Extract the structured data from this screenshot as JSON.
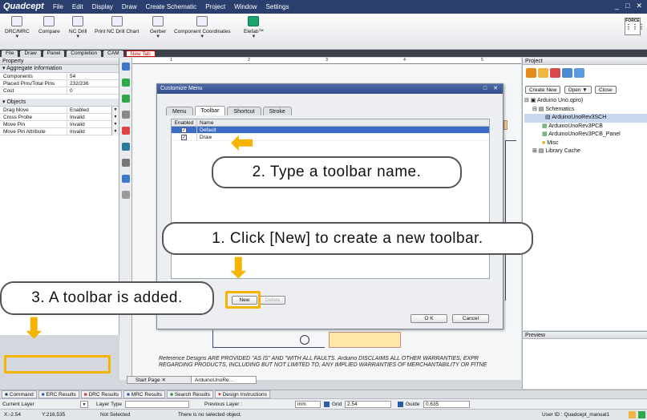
{
  "app": {
    "name": "Quadcept",
    "menus": [
      "File",
      "Edit",
      "Display",
      "Draw",
      "Create Schematic",
      "Project",
      "Window",
      "Settings"
    ]
  },
  "toolbar": {
    "items": [
      "DRC/MRC",
      "Compare",
      "NC Drill",
      "Print NC Drill Chart",
      "Gerber",
      "Component Coordinates",
      "Elefab™"
    ],
    "force_label": "FORCE"
  },
  "doc_tabs": [
    "File",
    "Draw",
    "Panel",
    "Completion",
    "CAM",
    "New Tab"
  ],
  "property_panel": {
    "title": "Property",
    "aggregate_title": "Aggregate Information",
    "aggregate_rows": [
      {
        "key": "Components",
        "value": "54"
      },
      {
        "key": "Placed Pins/Total Pins",
        "value": "232/236"
      },
      {
        "key": "Cost",
        "value": "0"
      }
    ],
    "objects_title": "Objects",
    "object_rows": [
      {
        "key": "Drag Move",
        "value": "Enabled"
      },
      {
        "key": "Cross Probe",
        "value": "Invalid"
      },
      {
        "key": "Move Pin",
        "value": "Invalid"
      },
      {
        "key": "Move Pin Attribute",
        "value": "Invalid"
      }
    ]
  },
  "ruler": [
    "1",
    "2",
    "3",
    "4",
    "5"
  ],
  "dialog": {
    "title": "Customize Menu",
    "tabs": [
      "Menu",
      "Toolbar",
      "Shortcut",
      "Stroke"
    ],
    "columns": [
      "Enabled",
      "Name"
    ],
    "rows": [
      {
        "name": "Default",
        "checked": true
      },
      {
        "name": "Draw",
        "checked": true
      }
    ],
    "new_label": "New",
    "delete_label": "Delete",
    "ok_label": "O K",
    "cancel_label": "Cancel"
  },
  "project_panel": {
    "title": "Project",
    "create_new": "Create New",
    "open": "Open ▼",
    "close": "Close",
    "tree": [
      "Arduino Uno.qpro)",
      "Schematics",
      "ArduinoUnoRev3SCH",
      "ArduinoUnoRev3PCB",
      "ArduinoUnoRev3PCB_Panel",
      "Misc",
      "Library Cache"
    ]
  },
  "preview_panel": {
    "title": "Preview"
  },
  "disclaimer": {
    "line1": "Reference Designs ARE PROVIDED \"AS IS\" AND \"WITH ALL FAULTS. Arduino DISCLAIMS ALL OTHER WARRANTIES, EXPR",
    "line2": "REGARDING PRODUCTS, INCLUDING BUT NOT LIMITED TO, ANY IMPLIED WARRANTIES OF MERCHANTABILITY OR FITNE"
  },
  "page_tabs": [
    "Start Page",
    "ArduinoUnoRe…"
  ],
  "bottom_tabs": [
    "Command",
    "ERC Results",
    "DRC Results",
    "MRC Results",
    "Search Results",
    "Design Instructions"
  ],
  "layerbar": {
    "current_layer": "Current Layer",
    "layer_type": "Layer Type",
    "previous_layer": "Previous Layer :",
    "unit": "mm",
    "grid_label": "Grid",
    "grid_value": "2.54",
    "guide_label": "Guide",
    "guide_value": "0.635"
  },
  "statusbar": {
    "x": "X:-2.54",
    "y": "Y:216.535",
    "selection": "Not Selected",
    "message": "There is no selected object.",
    "user": "User ID : Quadcept_manual1"
  },
  "callouts": {
    "step1": "1. Click [New] to create a new toolbar.",
    "step2": "2. Type a toolbar name.",
    "step3": "3. A toolbar is added."
  },
  "colors": {
    "accent": "#f4b400",
    "titlebar": "#2a3f6e",
    "selection": "#3b6cc6"
  }
}
